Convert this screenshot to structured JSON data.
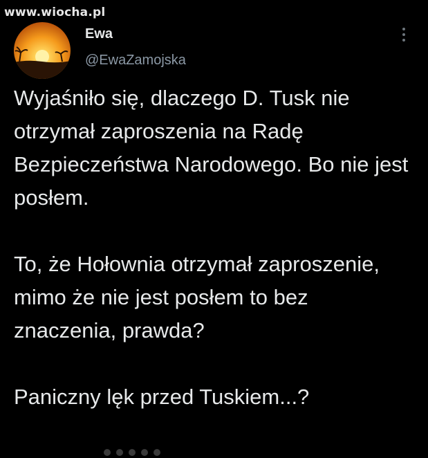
{
  "watermark": {
    "text": "www.wiocha.pl"
  },
  "tweet": {
    "author": {
      "name": "Ewa",
      "handle": "@EwaZamojska"
    },
    "paragraphs": [
      "Wyjaśniło się, dlaczego D. Tusk nie otrzymał zaproszenia na Radę Bezpieczeństwa Narodowego. Bo nie jest posłem.",
      "To, że Hołownia otrzymał zaproszenie, mimo że nie jest posłem to bez znaczenia, prawda?",
      "Paniczny lęk przed Tuskiem...?"
    ]
  },
  "icons": {
    "more": "more-vertical-icon",
    "avatar": "sunset-avatar"
  },
  "colors": {
    "background": "#000000",
    "text_primary": "#e7e9ea",
    "text_secondary": "#8b98a5",
    "avatar_sky": "#f59a1c",
    "avatar_sun": "#fff2a8"
  }
}
